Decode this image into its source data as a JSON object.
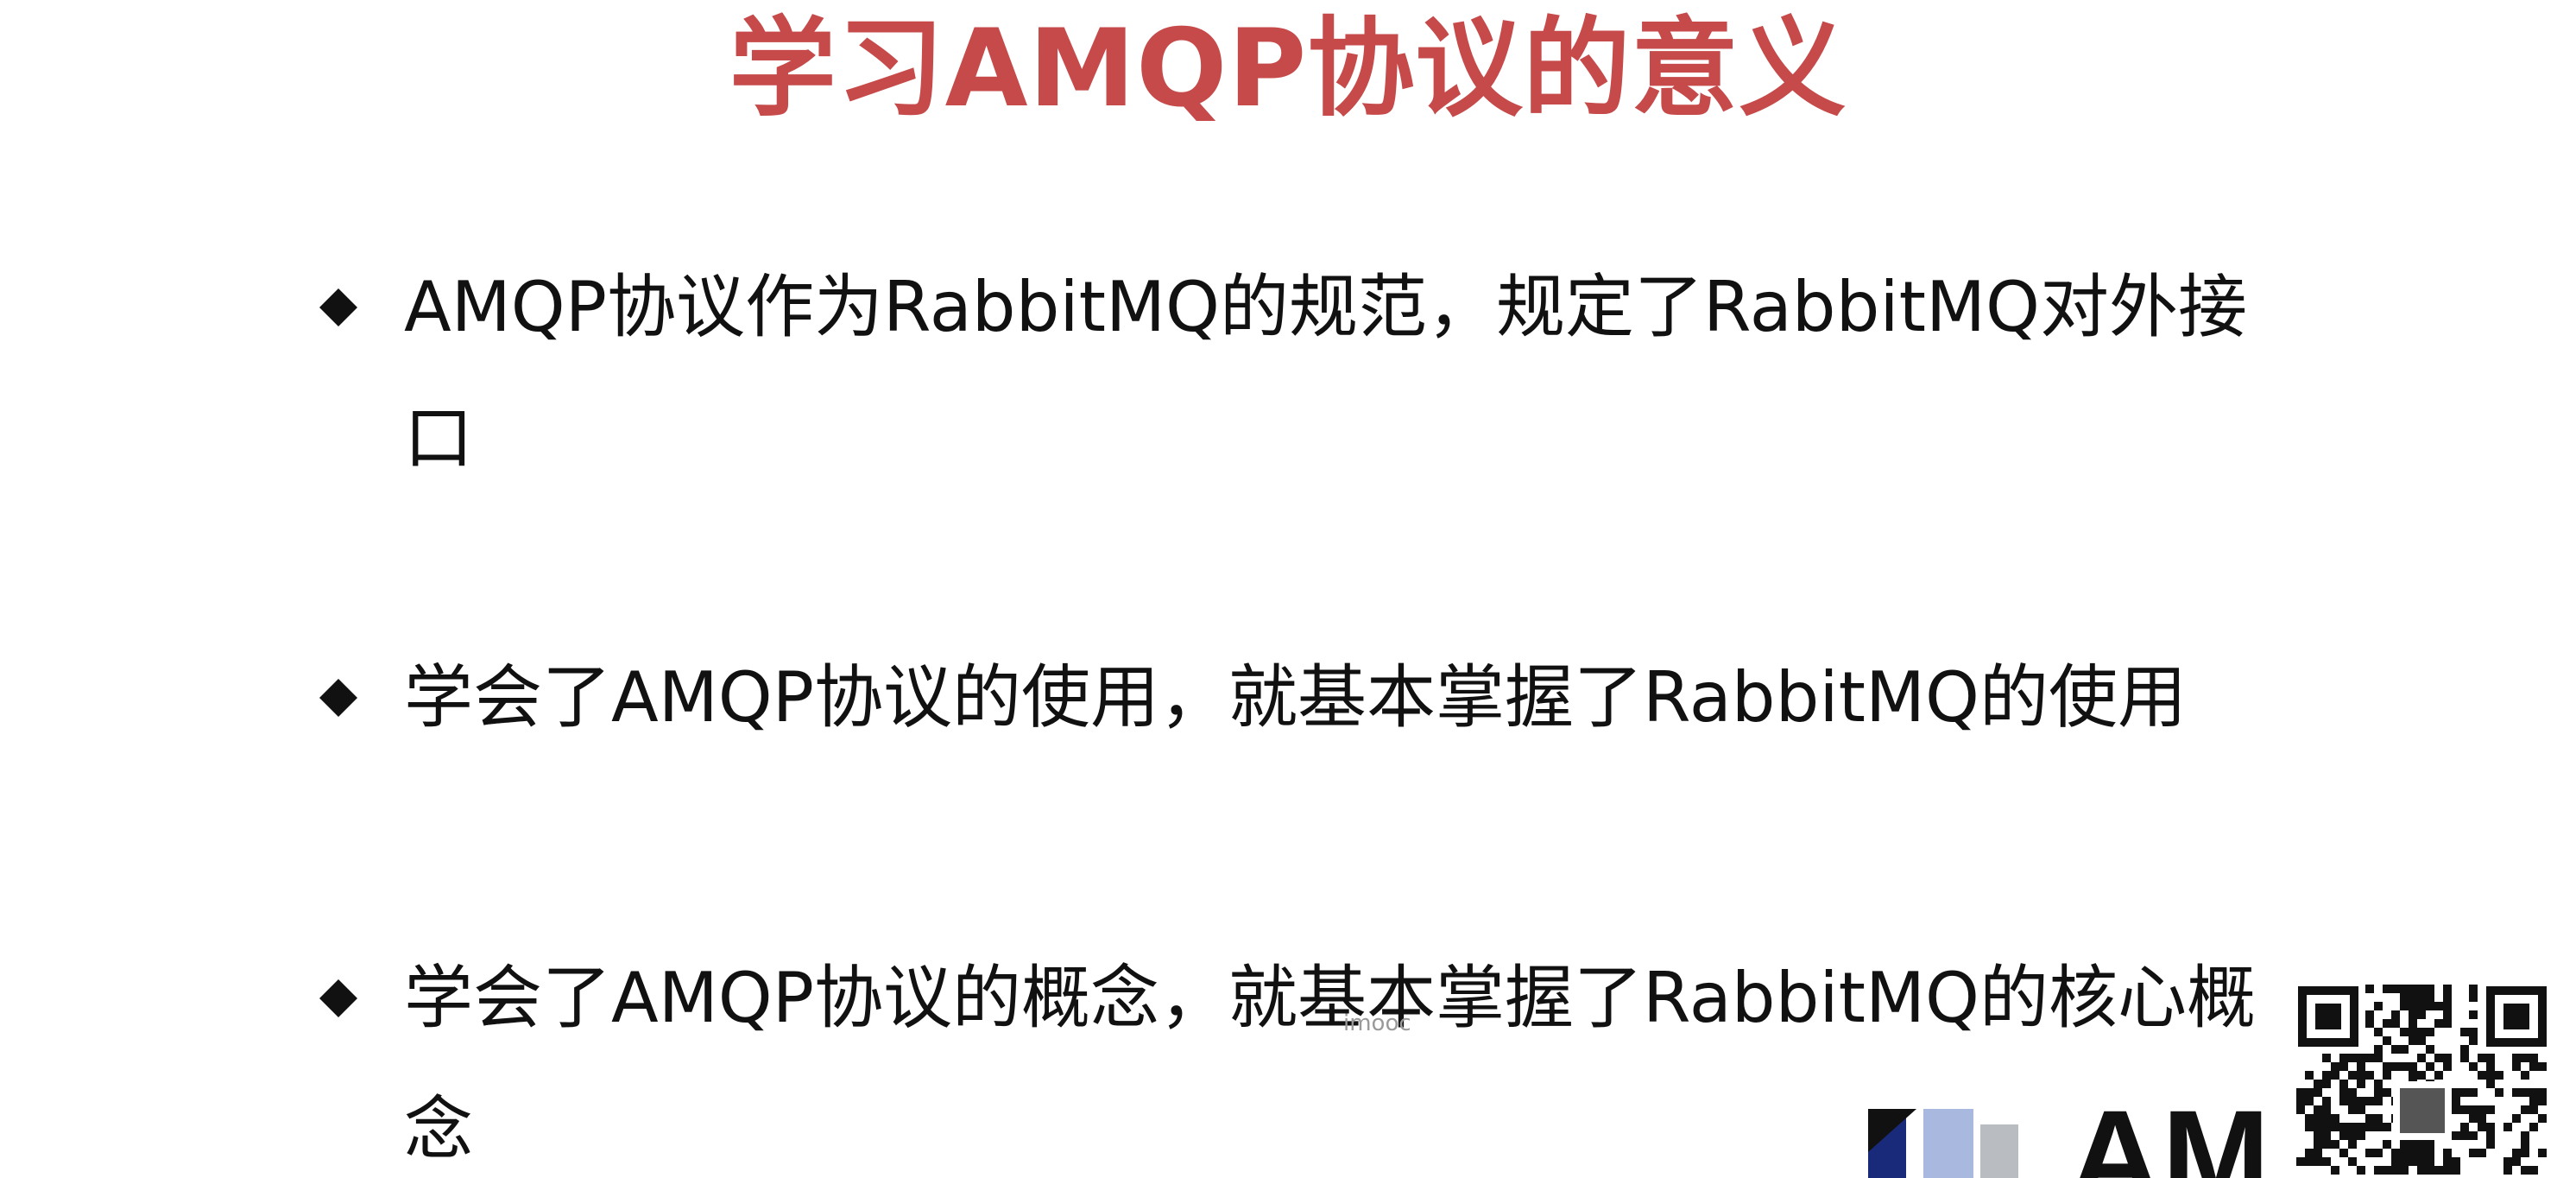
{
  "slide": {
    "title": "学习AMQP协议的意义",
    "title_color": "#c64a4a",
    "text_color": "#111111"
  },
  "bullets": [
    {
      "marker": "diamond",
      "text": "AMQP协议作为RabbitMQ的规范，规定了RabbitMQ对外接口"
    },
    {
      "marker": "diamond",
      "text": "学会了AMQP协议的使用，就基本掌握了RabbitMQ的使用"
    },
    {
      "marker": "diamond",
      "text": "学会了AMQP协议的概念，就基本掌握了RabbitMQ的核心概念"
    }
  ],
  "watermark": {
    "text": "imooc"
  },
  "logo": {
    "text": "AM",
    "colors": {
      "navy": "#1a2a7a",
      "light_blue": "#a9b8de",
      "gray": "#b9bcc0",
      "black": "#111111"
    }
  },
  "qr": {
    "icon": "qr-code-icon"
  }
}
